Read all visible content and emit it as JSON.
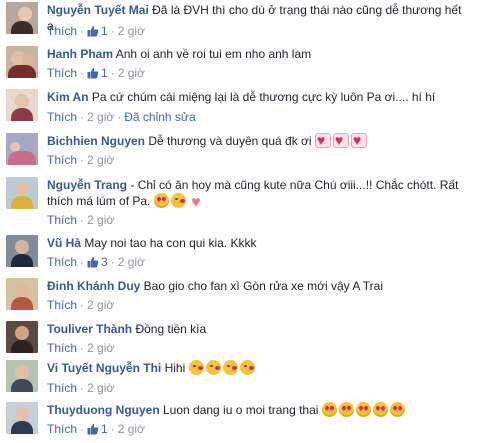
{
  "colors": {
    "author": "#365899",
    "action": "#4267b2",
    "meta": "#90949c",
    "text": "#1d2129"
  },
  "comments": [
    {
      "author": "Nguyễn Tuyết Mai",
      "text": "Đã là ĐVH thì cho dù ở trạng thái nào cũng dễ thương hết ạ.",
      "like_label": "Thích",
      "like_count": "1",
      "time": "2 giờ"
    },
    {
      "author": "Hanh Pham",
      "text": "Anh oi anh về roi tui em nho anh lam",
      "like_label": "Thích",
      "like_count": "1",
      "time": "2 giờ"
    },
    {
      "author": "Kim An",
      "text": "Pa cứ chúm cái miệng lại là dễ thương cực kỳ luôn Pa ơi.... hí hí",
      "like_label": "Thích",
      "time": "2 giờ",
      "edited_label": "Đã chỉnh sửa"
    },
    {
      "author": "Bichhien Nguyen",
      "text": "Dễ thương và duyên quá đk ơi",
      "like_label": "Thích",
      "time": "2 giờ"
    },
    {
      "author": "Nguyễn Trang",
      "text": "- Chỉ có ăn hoy mà cũng kute nữa Chú ơiii...!! Chắc chótt. Rất thích má lúm of Pa.",
      "like_label": "Thích",
      "time": "2 giờ"
    },
    {
      "author": "Vũ Hà",
      "text": "May noi tao ha con qui kia. Kkkk",
      "like_label": "Thích",
      "like_count": "3",
      "time": "2 giờ"
    },
    {
      "author": "Đinh Khánh Duy",
      "text": "Bao gio cho fan xì Gòn rửa xe mới vậy A Trai",
      "like_label": "Thích",
      "time": "2 giờ"
    },
    {
      "author": "Touliver Thành",
      "text": "Đồng tiền kìa",
      "like_label": "Thích",
      "time": "2 giờ"
    },
    {
      "author": "Vi Tuyết Nguyễn Thi",
      "text": "Hihi",
      "like_label": "Thích",
      "time": "2 giờ"
    },
    {
      "author": "Thuyduong Nguyen",
      "text": "Luon dang iu o moi trang thai",
      "like_label": "Thích",
      "like_count": "1",
      "time": "2 giờ"
    }
  ],
  "icons": {
    "like": "thumbs-up-icon",
    "heart_eyes": "heart-eyes-emoji-icon",
    "kiss": "kissing-face-emoji-icon",
    "heart_box": "heart-box-emoji-icon",
    "heart": "red-heart-icon"
  }
}
